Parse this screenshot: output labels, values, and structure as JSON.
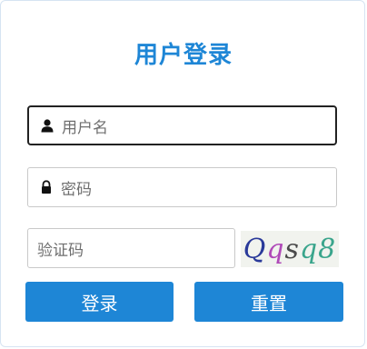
{
  "form": {
    "title": "用户登录",
    "username": {
      "placeholder": "用户名",
      "value": ""
    },
    "password": {
      "placeholder": "密码",
      "value": ""
    },
    "captcha": {
      "placeholder": "验证码",
      "value": ""
    },
    "captcha_image": {
      "chars": [
        "Q",
        "q",
        "s",
        "q",
        "8"
      ],
      "colors": [
        "#2a3a9a",
        "#b04ab8",
        "#4a4a4a",
        "#3aa58c",
        "#3aa58c"
      ]
    },
    "login_label": "登录",
    "reset_label": "重置"
  },
  "colors": {
    "accent": "#1e86d6",
    "border": "#c9c9c9",
    "placeholder": "#6f6f6f"
  }
}
